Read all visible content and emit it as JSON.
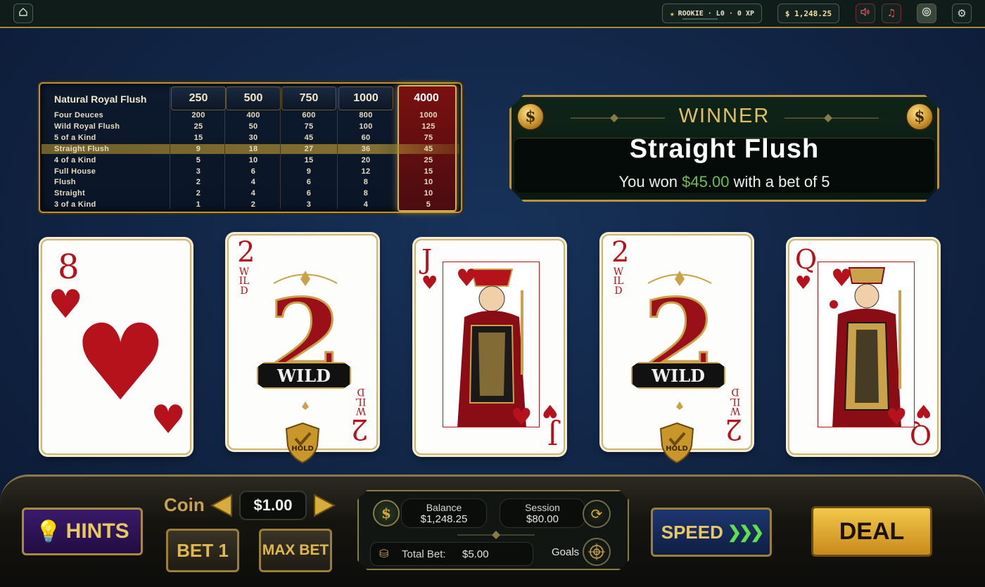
{
  "topbar": {
    "level_text": "ROOKIE · L0 · 0 XP",
    "balance_text": "$ 1,248.25",
    "icons": [
      "home-icon",
      "star-icon",
      "volume-icon",
      "music-icon",
      "target-icon",
      "gear-icon"
    ]
  },
  "paytable": {
    "header_label": "Natural Royal Flush",
    "columns": [
      "250",
      "500",
      "750",
      "1000",
      "4000"
    ],
    "rows": [
      {
        "name": "Four Deuces",
        "values": [
          "200",
          "400",
          "600",
          "800",
          "1000"
        ]
      },
      {
        "name": "Wild Royal Flush",
        "values": [
          "25",
          "50",
          "75",
          "100",
          "125"
        ]
      },
      {
        "name": "5 of a Kind",
        "values": [
          "15",
          "30",
          "45",
          "60",
          "75"
        ]
      },
      {
        "name": "Straight Flush",
        "values": [
          "9",
          "18",
          "27",
          "36",
          "45"
        ]
      },
      {
        "name": "4 of a Kind",
        "values": [
          "5",
          "10",
          "15",
          "20",
          "25"
        ]
      },
      {
        "name": "Full House",
        "values": [
          "3",
          "6",
          "9",
          "12",
          "15"
        ]
      },
      {
        "name": "Flush",
        "values": [
          "2",
          "4",
          "6",
          "8",
          "10"
        ]
      },
      {
        "name": "Straight",
        "values": [
          "2",
          "4",
          "6",
          "8",
          "10"
        ]
      },
      {
        "name": "3 of a Kind",
        "values": [
          "1",
          "2",
          "3",
          "4",
          "5"
        ]
      }
    ],
    "highlighted_row": "Straight Flush",
    "active_column": "4000"
  },
  "winner": {
    "title": "WINNER",
    "hand": "Straight Flush",
    "prefix": "You won ",
    "amount": "$45.00",
    "suffix": " with a bet of 5",
    "coin_symbol": "$",
    "amount_color": "#6bbf4a"
  },
  "cards": [
    {
      "rank": "8",
      "suit": "♥",
      "type": "number",
      "held": false
    },
    {
      "rank": "2",
      "suit": "WILD",
      "type": "wild",
      "held": true,
      "wild_side": "WILD",
      "banner": "WILD"
    },
    {
      "rank": "J",
      "suit": "♥",
      "type": "face",
      "held": false
    },
    {
      "rank": "2",
      "suit": "WILD",
      "type": "wild",
      "held": true,
      "wild_side": "WILD",
      "banner": "WILD"
    },
    {
      "rank": "Q",
      "suit": "♥",
      "type": "face",
      "held": false
    }
  ],
  "hold_label": "HOLD",
  "controls": {
    "hints": "HINTS",
    "coin_label": "Coin",
    "coin_value": "$1.00",
    "bet1": "BET 1",
    "max_bet": "MAX BET",
    "speed": "SPEED",
    "speed_arrows": "❯❯❯",
    "deal": "DEAL",
    "balance_label": "Balance",
    "balance_value": "$1,248.25",
    "session_label": "Session",
    "session_value": "$80.00",
    "total_bet_label": "Total Bet:",
    "total_bet_value": "$5.00",
    "goals_label": "Goals"
  },
  "colors": {
    "gold": "#c9a24a",
    "red": "#b5121b",
    "green_arrow": "#5fe04a"
  }
}
